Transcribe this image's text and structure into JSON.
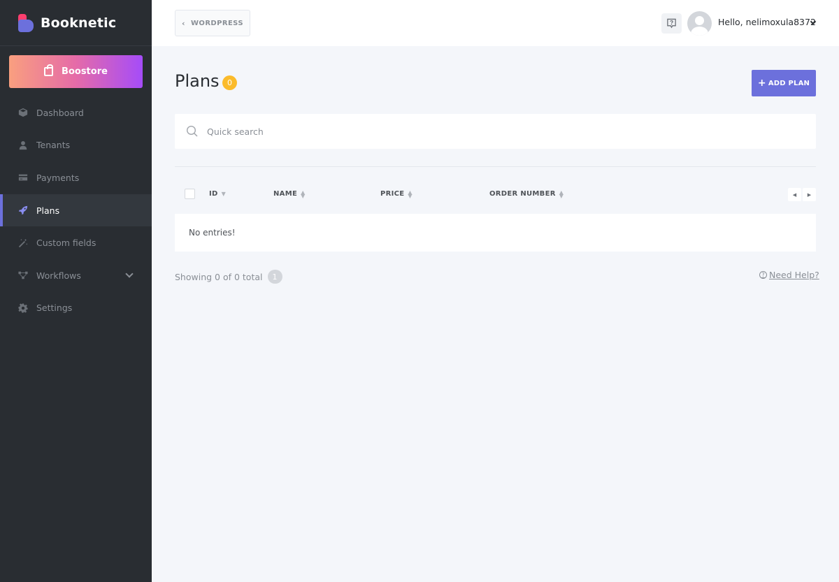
{
  "app": {
    "name": "Booknetic"
  },
  "sidebar": {
    "boostore_label": "Boostore",
    "items": [
      {
        "label": "Dashboard",
        "icon": "box-icon"
      },
      {
        "label": "Tenants",
        "icon": "user-icon"
      },
      {
        "label": "Payments",
        "icon": "credit-card-icon"
      },
      {
        "label": "Plans",
        "icon": "rocket-icon",
        "active": true
      },
      {
        "label": "Custom fields",
        "icon": "magic-wand-icon"
      },
      {
        "label": "Workflows",
        "icon": "workflow-icon",
        "expandable": true
      },
      {
        "label": "Settings",
        "icon": "gear-icon"
      }
    ]
  },
  "topbar": {
    "back_label": "WORDPRESS",
    "greeting": "Hello, nelimoxula8372"
  },
  "page": {
    "title": "Plans",
    "count": "0",
    "add_button_label": "ADD PLAN"
  },
  "search": {
    "placeholder": "Quick search"
  },
  "table": {
    "columns": [
      "ID",
      "NAME",
      "PRICE",
      "ORDER NUMBER"
    ],
    "empty_text": "No entries!"
  },
  "footer": {
    "showing_text": "Showing 0 of 0 total",
    "page_number": "1",
    "help_label": "Need Help?"
  },
  "colors": {
    "sidebar_bg": "#292d32",
    "accent": "#6c70dc",
    "badge": "#fbbb2b",
    "background": "#f4f6fa"
  }
}
